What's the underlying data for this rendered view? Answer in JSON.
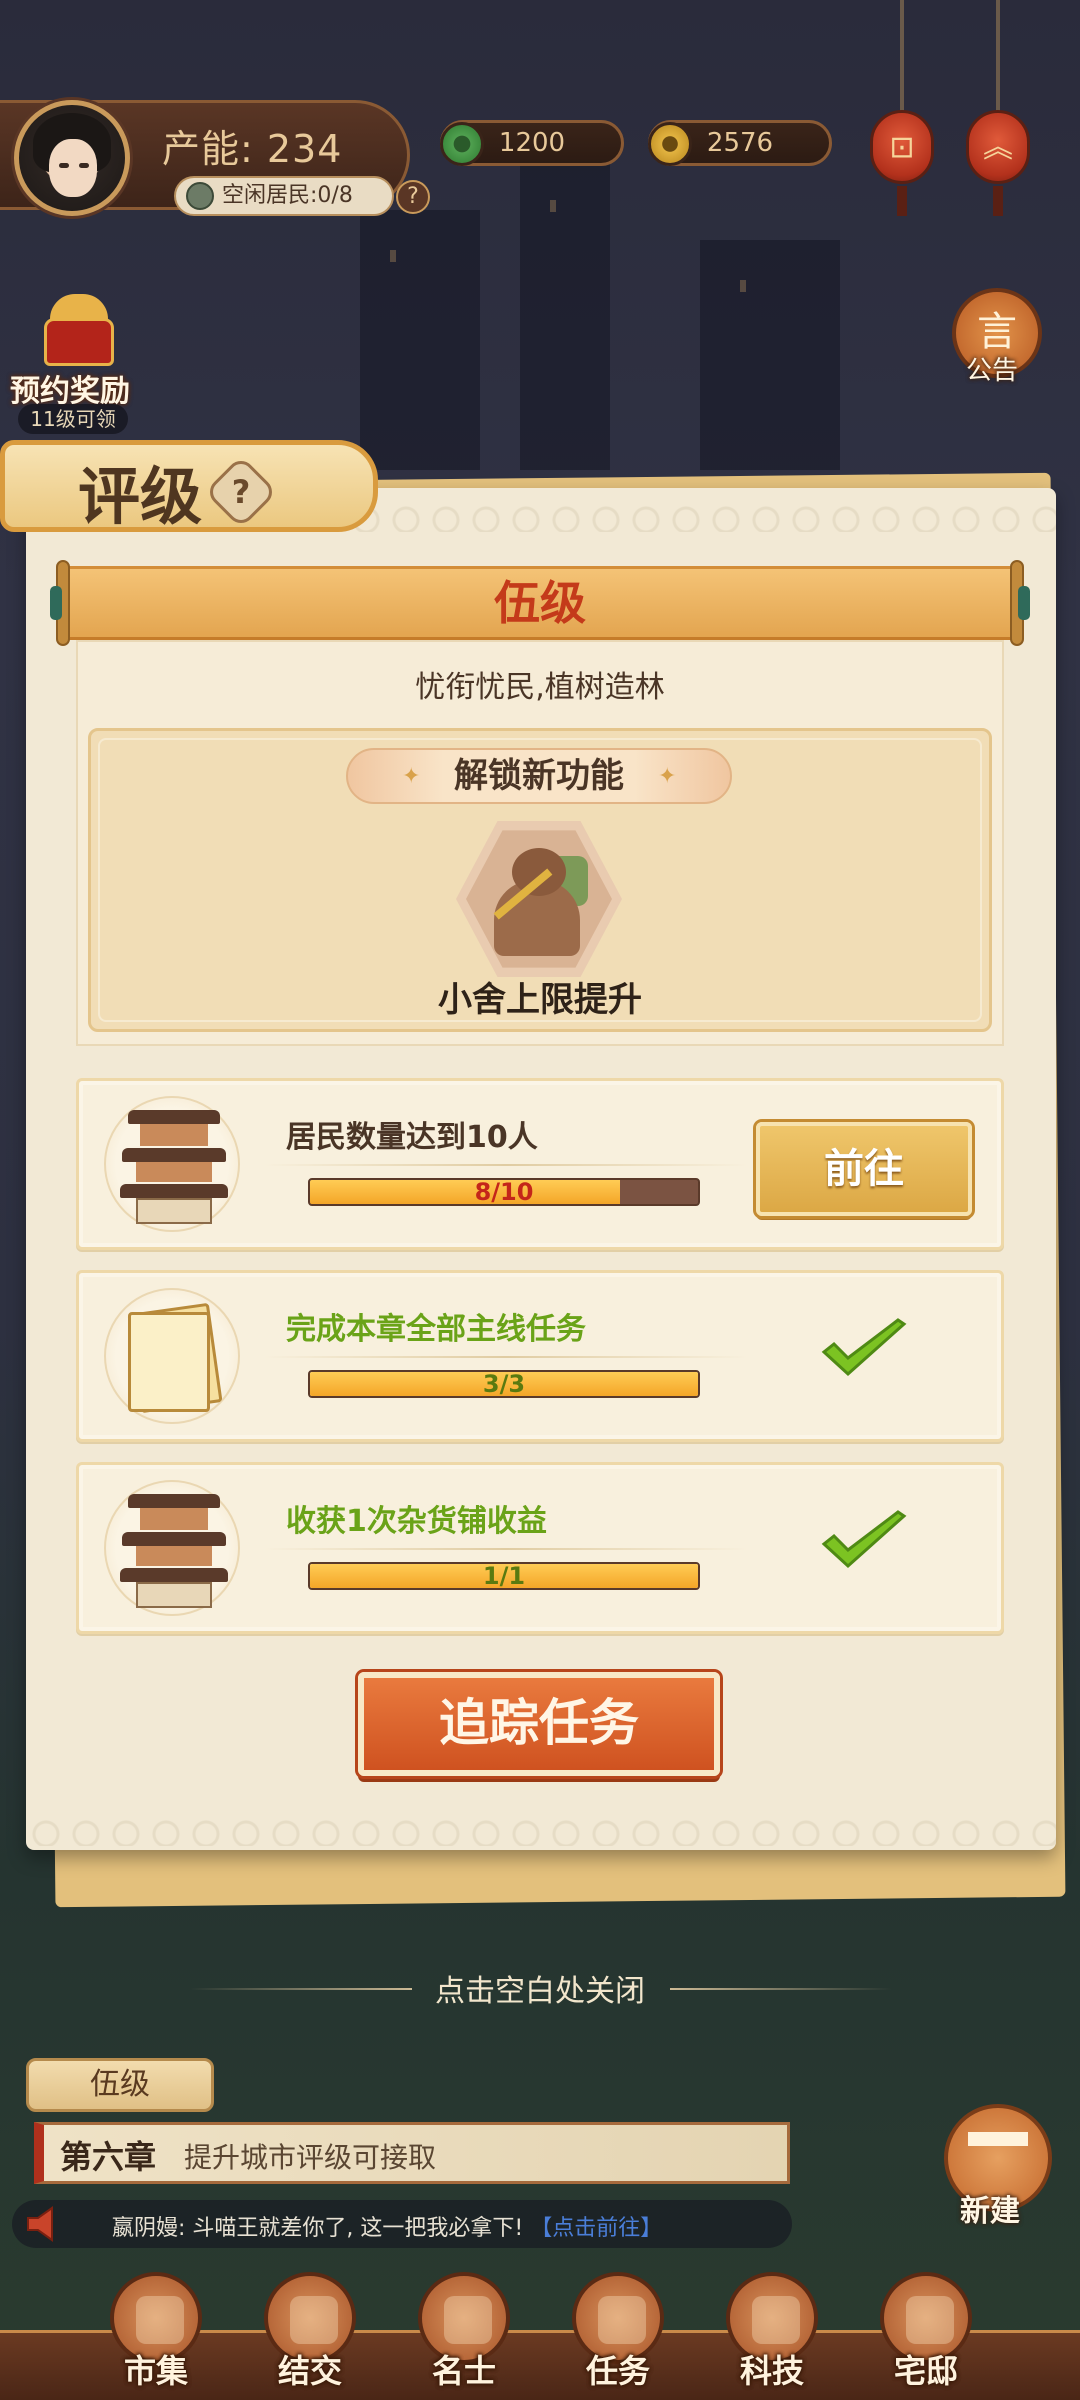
{
  "hud": {
    "capacity_label": "产能: 234",
    "idle_residents": "空闲居民:0/8",
    "help_mark": "?",
    "jade_coins": "1200",
    "gold_coins": "2576",
    "announcement_label": "公告",
    "announcement_glyph": "言",
    "reserve_reward_label": "预约奖励",
    "reserve_reward_sub": "11级可领"
  },
  "rating_panel": {
    "title": "评级",
    "help_mark": "?",
    "level_name": "伍级",
    "motto": "忧衔忧民,植树造林",
    "unlock_label": "解锁新功能",
    "unlock_sparkle": "✦",
    "feature_name": "小舍上限提升",
    "tasks": [
      {
        "text": "居民数量达到10人",
        "progress_current": "8",
        "progress_total": "10",
        "progress_text": "8/10",
        "progress_fraction": 0.8,
        "completed": false,
        "action_label": "前往"
      },
      {
        "text": "完成本章全部主线任务",
        "progress_current": "3",
        "progress_total": "3",
        "progress_text": "3/3",
        "progress_fraction": 1.0,
        "completed": true
      },
      {
        "text": "收获1次杂货铺收益",
        "progress_current": "1",
        "progress_total": "1",
        "progress_text": "1/1",
        "progress_fraction": 1.0,
        "completed": true
      }
    ],
    "track_button_label": "追踪任务"
  },
  "close_hint": "点击空白处关闭",
  "chapter": {
    "rank_tag": "伍级",
    "name": "第六章",
    "hint": "提升城市评级可接取"
  },
  "ticker": {
    "message": "嬴阴嫚: 斗喵王就差你了, 这一把我必拿下!",
    "link": "【点击前往】"
  },
  "build_label": "新建",
  "nav": [
    {
      "label": "市集"
    },
    {
      "label": "结交"
    },
    {
      "label": "名士"
    },
    {
      "label": "任务"
    },
    {
      "label": "科技"
    },
    {
      "label": "宅邸"
    }
  ],
  "colors": {
    "progress_fill": "#f4a628",
    "completed_text": "#6aa318",
    "pending_text": "#4a3526",
    "track_button": "#cf5220",
    "level_text": "#c43a1a"
  },
  "icons": {
    "jade_coin": "jade-coin-icon",
    "gold_coin": "gold-coin-icon",
    "check": "checkmark-icon",
    "speaker": "speaker-icon"
  }
}
